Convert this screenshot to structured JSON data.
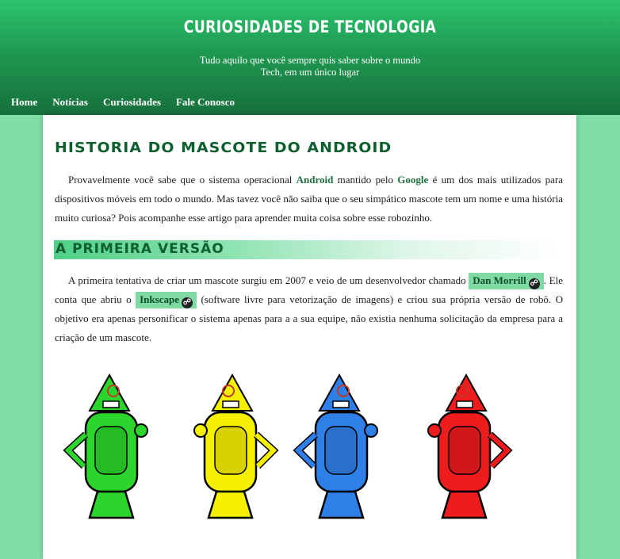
{
  "header": {
    "title": "CURIOSIDADES DE TECNOLOGIA",
    "subtitle_line1": "Tudo aquilo que você sempre quis saber sobre o mundo",
    "subtitle_line2": "Tech, em um único lugar"
  },
  "nav": {
    "items": [
      {
        "label": "Home"
      },
      {
        "label": "Notícias"
      },
      {
        "label": "Curiosidades"
      },
      {
        "label": "Fale Conosco"
      }
    ]
  },
  "article": {
    "title": "HISTORIA DO MASCOTE DO ANDROID",
    "p1": {
      "t1": "Provavelmente você sabe que o sistema operacional ",
      "android": "Android",
      "t2": " mantido pelo ",
      "google": "Google",
      "t3": " é um dos mais utilizados para dispositivos móveis em todo o mundo. Mas tavez você não saiba que o seu simpático mascote tem um nome e uma história muito curiosa? Pois acompanhe esse artigo para aprender muita coisa sobre esse robozinho."
    },
    "section_title": "A PRIMEIRA VERSÃO",
    "p2": {
      "t1": "A primeira tentativa de criar um mascote surgiu em 2007 e veio de um desenvolvedor chamado ",
      "link1": "Dan Morrill",
      "t2": ". Ele conta que abriu o ",
      "link2": "Inkscape",
      "t3": " (software livre para vetorização de imagens) e criou sua própria versão de robô. O objetivo era apenas personificar o sistema apenas para a a sua equipe, não existia nenhuma solicitação da empresa para a criação de um mascote."
    },
    "image": {
      "robot_colors": [
        "#2bd52b",
        "#f5f000",
        "#2f7fe8",
        "#ee1c1c"
      ]
    }
  }
}
